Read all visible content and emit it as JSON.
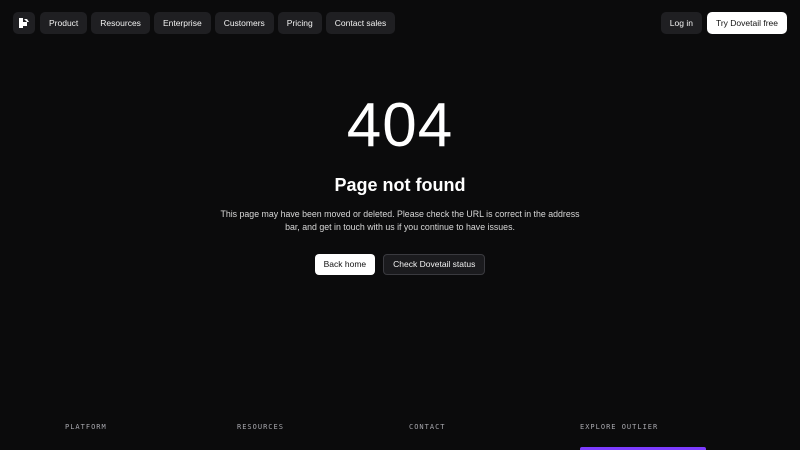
{
  "nav": {
    "logo_icon": "dovetail-logo-icon",
    "items": [
      {
        "label": "Product"
      },
      {
        "label": "Resources"
      },
      {
        "label": "Enterprise"
      },
      {
        "label": "Customers"
      },
      {
        "label": "Pricing"
      },
      {
        "label": "Contact sales"
      }
    ],
    "login_label": "Log in",
    "cta_label": "Try Dovetail free"
  },
  "main": {
    "code": "404",
    "title": "Page not found",
    "description": "This page may have been moved or deleted. Please check the URL is correct in the address bar, and get in touch with us if you continue to have issues.",
    "back_label": "Back home",
    "status_label": "Check Dovetail status"
  },
  "footer": {
    "headings": [
      "PLATFORM",
      "RESOURCES",
      "CONTACT",
      "EXPLORE OUTLIER"
    ],
    "accent_color": "#7d3cff"
  },
  "colors": {
    "background": "#0b0b0c",
    "button_dark": "#1f1f22",
    "button_light": "#ffffff"
  }
}
